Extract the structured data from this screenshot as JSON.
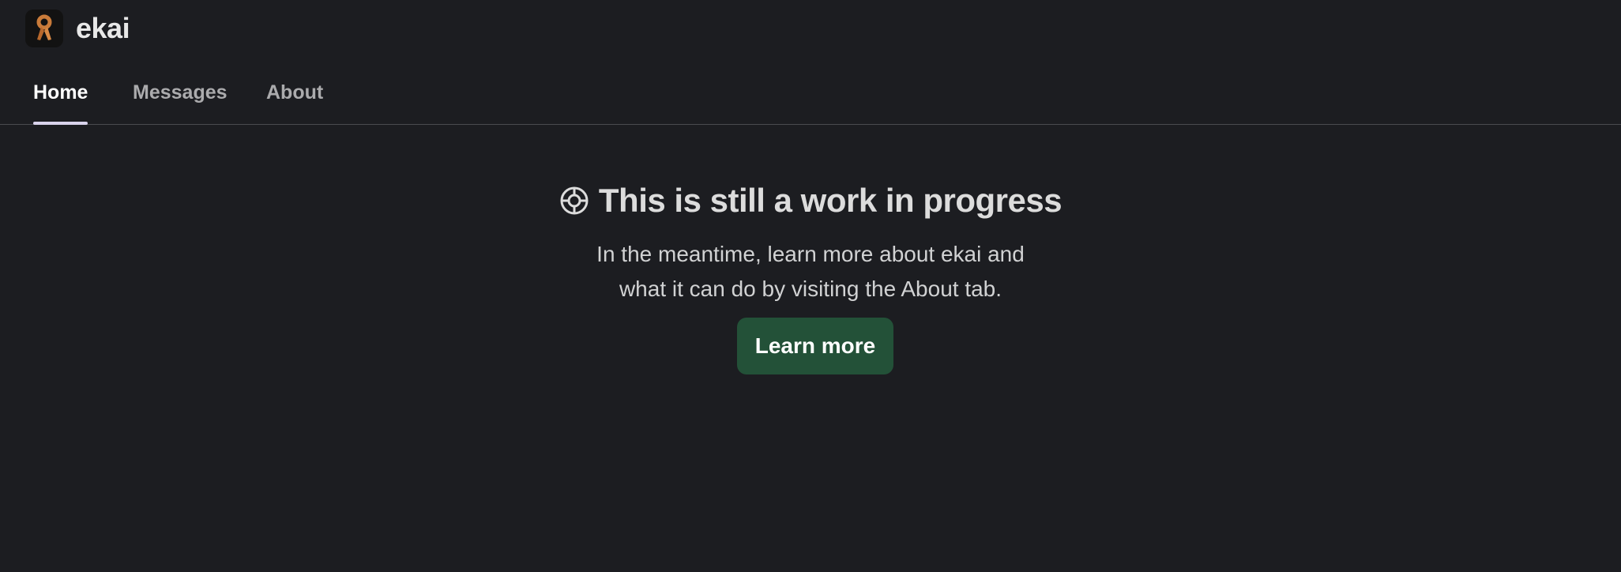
{
  "app": {
    "title": "ekai",
    "icon": "ribbon-logo-icon",
    "accent_color": "#c97b3a"
  },
  "tabs": [
    {
      "label": "Home",
      "active": true
    },
    {
      "label": "Messages",
      "active": false
    },
    {
      "label": "About",
      "active": false
    }
  ],
  "main": {
    "heading": "This is still a work in progress",
    "heading_icon": "lifebuoy-icon",
    "body_line_1": "In the meantime, learn more about ekai and",
    "body_line_2": "what it can do by visiting the About tab.",
    "button_label": "Learn more",
    "button_color": "#235138"
  }
}
